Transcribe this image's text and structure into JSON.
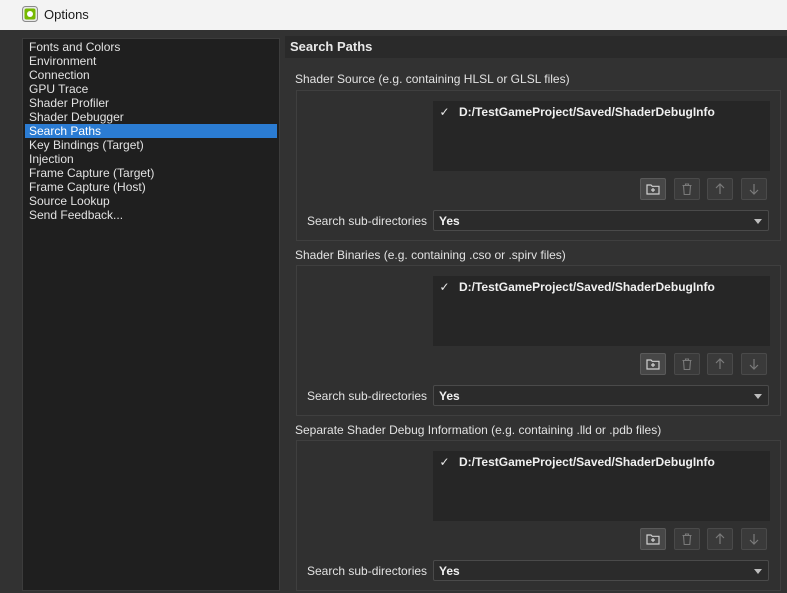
{
  "window": {
    "title": "Options"
  },
  "sidebar": {
    "items": [
      {
        "label": "Fonts and Colors",
        "selected": false
      },
      {
        "label": "Environment",
        "selected": false
      },
      {
        "label": "Connection",
        "selected": false
      },
      {
        "label": "GPU Trace",
        "selected": false
      },
      {
        "label": "Shader Profiler",
        "selected": false
      },
      {
        "label": "Shader Debugger",
        "selected": false
      },
      {
        "label": "Search Paths",
        "selected": true
      },
      {
        "label": "Key Bindings (Target)",
        "selected": false
      },
      {
        "label": "Injection",
        "selected": false
      },
      {
        "label": "Frame Capture (Target)",
        "selected": false
      },
      {
        "label": "Frame Capture (Host)",
        "selected": false
      },
      {
        "label": "Source Lookup",
        "selected": false
      },
      {
        "label": "Send Feedback...",
        "selected": false
      }
    ]
  },
  "main": {
    "title": "Search Paths",
    "groups": [
      {
        "title": "Shader Source (e.g. containing HLSL or GLSL files)",
        "paths": [
          {
            "checked": true,
            "check_glyph": "✓",
            "path": "D:/TestGameProject/Saved/ShaderDebugInfo"
          }
        ],
        "subdir_label": "Search sub-directories",
        "subdir_value": "Yes"
      },
      {
        "title": "Shader Binaries (e.g. containing .cso or .spirv files)",
        "paths": [
          {
            "checked": true,
            "check_glyph": "✓",
            "path": "D:/TestGameProject/Saved/ShaderDebugInfo"
          }
        ],
        "subdir_label": "Search sub-directories",
        "subdir_value": "Yes"
      },
      {
        "title": "Separate Shader Debug Information (e.g. containing .lld or .pdb files)",
        "paths": [
          {
            "checked": true,
            "check_glyph": "✓",
            "path": "D:/TestGameProject/Saved/ShaderDebugInfo"
          }
        ],
        "subdir_label": "Search sub-directories",
        "subdir_value": "Yes"
      }
    ]
  },
  "toolbar": {
    "buttons": [
      {
        "icon": "add-folder-icon",
        "enabled": true
      },
      {
        "icon": "trash-icon",
        "enabled": false
      },
      {
        "icon": "arrow-up-icon",
        "enabled": false
      },
      {
        "icon": "arrow-down-icon",
        "enabled": false
      }
    ]
  },
  "colors": {
    "accent": "#2b7cd3",
    "background": "#323232",
    "list_background": "#262626"
  }
}
